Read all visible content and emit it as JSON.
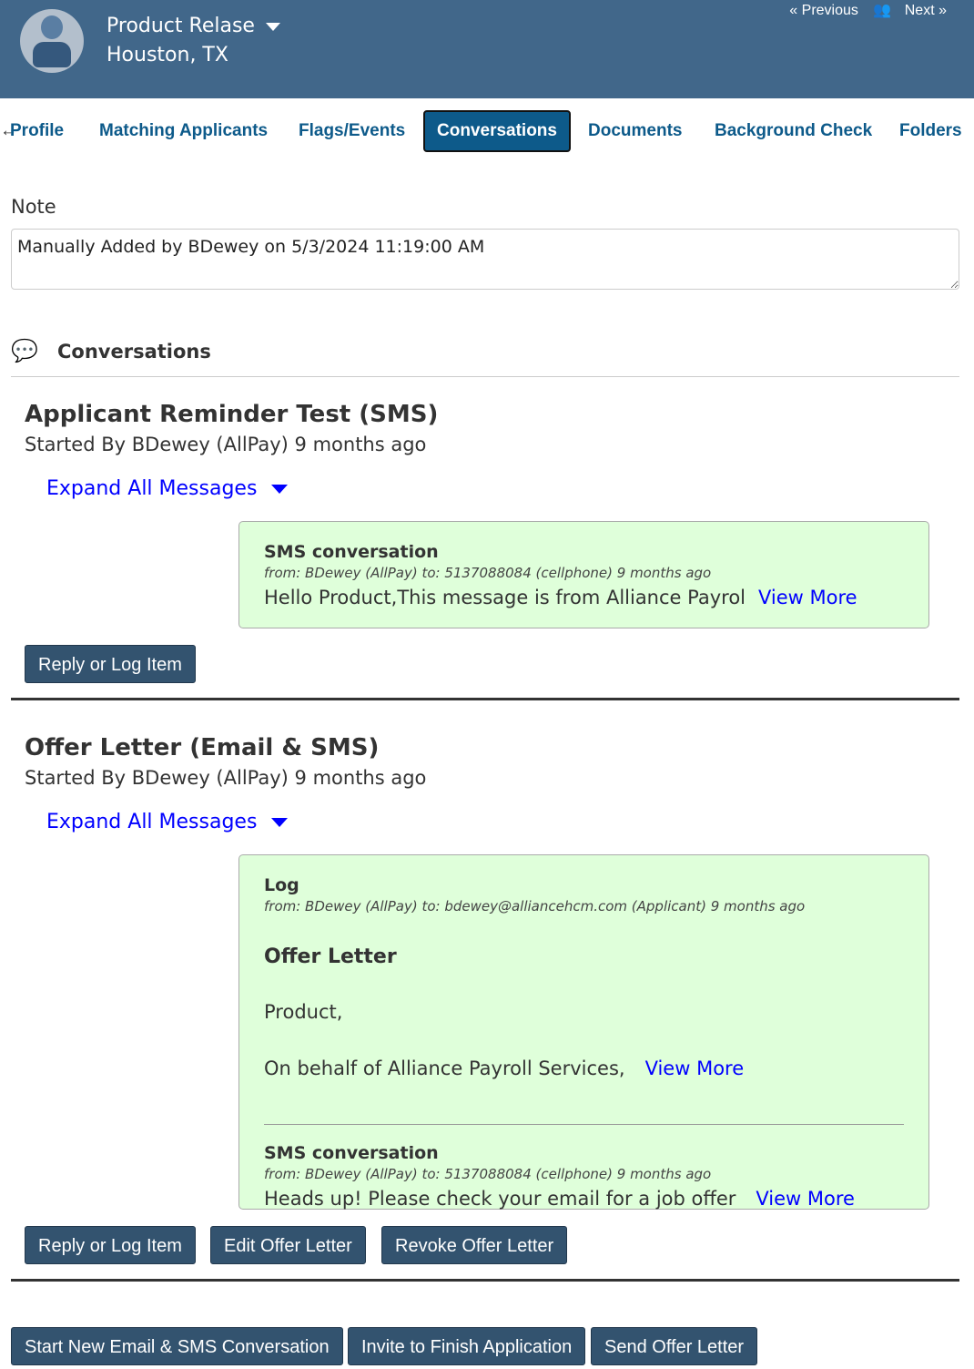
{
  "header": {
    "name": "Product Relase",
    "location": "Houston, TX",
    "previous": "Previous",
    "next": "Next"
  },
  "tabs": [
    {
      "label": "Profile"
    },
    {
      "label": "Matching Applicants"
    },
    {
      "label": "Flags/Events"
    },
    {
      "label": "Conversations",
      "active": true
    },
    {
      "label": "Documents"
    },
    {
      "label": "Background Check"
    },
    {
      "label": "Folders"
    }
  ],
  "note": {
    "label": "Note",
    "value": "Manually Added by BDewey on 5/3/2024 11:19:00 AM"
  },
  "conversations_title": "Conversations",
  "sections": [
    {
      "title": "Applicant Reminder Test (SMS)",
      "subtitle": "Started By BDewey (AllPay) 9 months ago",
      "expand": "Expand All Messages",
      "messages": [
        {
          "type": "SMS conversation",
          "meta": "from: BDewey (AllPay) to: 5137088084 (cellphone) 9 months ago",
          "body": "Hello Product,This message is from Alliance Payrol",
          "view_more": "View More"
        }
      ],
      "buttons": [
        "Reply or Log Item"
      ]
    },
    {
      "title": "Offer Letter (Email & SMS)",
      "subtitle": "Started By BDewey (AllPay) 9 months ago",
      "expand": "Expand All Messages",
      "messages": [
        {
          "type": "Log",
          "meta": "from: BDewey (AllPay) to: bdewey@alliancehcm.com (Applicant) 9 months ago",
          "heading": "Offer Letter",
          "greeting": "Product,",
          "body": "On behalf of Alliance Payroll Services,",
          "view_more": "View More"
        },
        {
          "type": "SMS conversation",
          "meta": "from: BDewey (AllPay) to: 5137088084 (cellphone) 9 months ago",
          "body": "Heads up! Please check your email for a job offer",
          "view_more": "View More"
        }
      ],
      "buttons": [
        "Reply or Log Item",
        "Edit Offer Letter",
        "Revoke Offer Letter"
      ]
    }
  ],
  "footer_buttons": [
    "Start New Email & SMS Conversation",
    "Invite to Finish Application",
    "Send Offer Letter"
  ],
  "colors": {
    "header": "#41678a",
    "tab_text": "#0d5a8a",
    "button": "#33536f",
    "card": "#dfffda",
    "link": "#0000ff"
  }
}
